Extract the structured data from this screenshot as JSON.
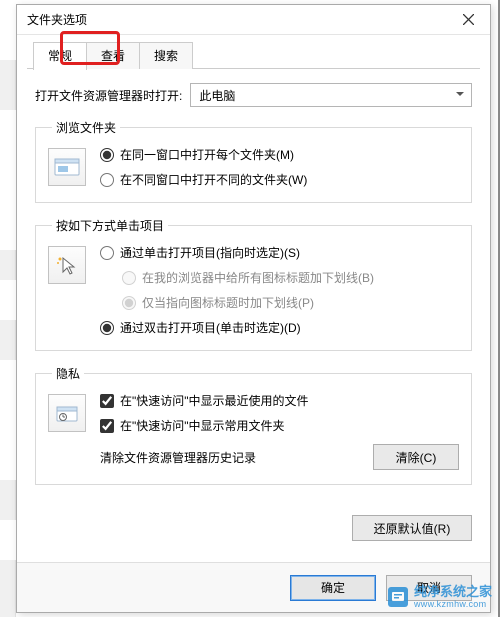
{
  "window": {
    "title": "文件夹选项"
  },
  "tabs": {
    "general": "常规",
    "view": "查看",
    "search": "搜索"
  },
  "open_explorer": {
    "label": "打开文件资源管理器时打开:",
    "value": "此电脑"
  },
  "browse": {
    "legend": "浏览文件夹",
    "same_window": "在同一窗口中打开每个文件夹(M)",
    "new_window": "在不同窗口中打开不同的文件夹(W)"
  },
  "click": {
    "legend": "按如下方式单击项目",
    "single": "通过单击打开项目(指向时选定)(S)",
    "underline_all": "在我的浏览器中给所有图标标题加下划线(B)",
    "underline_point": "仅当指向图标标题时加下划线(P)",
    "double": "通过双击打开项目(单击时选定)(D)"
  },
  "privacy": {
    "legend": "隐私",
    "recent_files": "在\"快速访问\"中显示最近使用的文件",
    "frequent_folders": "在\"快速访问\"中显示常用文件夹",
    "clear_label": "清除文件资源管理器历史记录",
    "clear_btn": "清除(C)"
  },
  "restore_defaults": "还原默认值(R)",
  "buttons": {
    "ok": "确定",
    "cancel": "取消"
  },
  "watermark": {
    "brand": "纯净系统之家",
    "url": "www.kzmhw.com"
  }
}
